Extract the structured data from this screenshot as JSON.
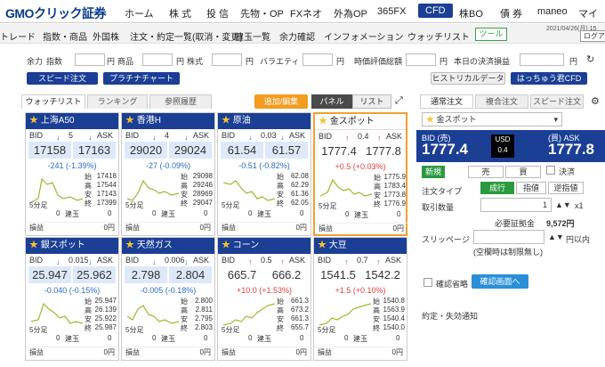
{
  "nav": {
    "logo": "GMOクリック証券",
    "items": [
      "ホーム",
      "株 式",
      "投 信",
      "先物・OP",
      "FXネオ",
      "外為OP",
      "365FX",
      "CFD",
      "株BO",
      "債 券",
      "maneo",
      "マイペー"
    ],
    "active_index": 7
  },
  "subnav": {
    "items": [
      "トレード",
      "指数・商品",
      "外国株",
      "注文・約定一覧(取消・変更)",
      "建玉一覧",
      "余力確認",
      "インフォメーション",
      "ウォッチリスト"
    ],
    "tool_label": "ツール",
    "datestamp": "2021/04/26(月) 15",
    "login_label": "ログア"
  },
  "infobar": {
    "labels": [
      "余力",
      "指数",
      "商品",
      "株式",
      "バラエティ",
      "時価評価総額",
      "本日の決済損益"
    ],
    "units": [
      "円",
      "円",
      "円",
      "円",
      "円",
      "円"
    ]
  },
  "buttons": {
    "speed": "スピード注文",
    "platinum": "プラチナチャート",
    "history": "ヒストリカルデータ",
    "hacchu": "はっちゅう君CFD",
    "add_edit": "追加/編集",
    "panel": "パネル",
    "list": "リスト",
    "confirm_skip": "確認省略",
    "confirm_screen": "確認画面へ"
  },
  "tabs": [
    "ウォッチリスト",
    "ランキング",
    "参照履歴"
  ],
  "cards": [
    {
      "name": "上海A50",
      "spread": "5",
      "bid": "17158",
      "ask": "17163",
      "chg": "-241 (-1.39%)",
      "dir": "down",
      "ohlc": [
        "17418",
        "17544",
        "17143",
        "17399"
      ],
      "tf": "5分足",
      "pos": "0",
      "pnl": "0円",
      "sel": false
    },
    {
      "name": "香港H",
      "spread": "4",
      "bid": "29020",
      "ask": "29024",
      "chg": "-27 (-0.09%)",
      "dir": "down",
      "ohlc": [
        "29098",
        "29246",
        "28969",
        "29047"
      ],
      "tf": "5分足",
      "pos": "0",
      "pnl": "0円",
      "sel": false
    },
    {
      "name": "原油",
      "spread": "0.03",
      "bid": "61.54",
      "ask": "61.57",
      "chg": "-0.51 (-0.82%)",
      "dir": "down",
      "ohlc": [
        "62.08",
        "62.29",
        "61.36",
        "62.05"
      ],
      "tf": "5分足",
      "pos": "0",
      "pnl": "0円",
      "sel": false
    },
    {
      "name": "金スポット",
      "spread": "0.4",
      "bid": "1777.4",
      "ask": "1777.8",
      "chg": "+0.5 (+0.03%)",
      "dir": "up",
      "ohlc": [
        "1775.9",
        "1783.4",
        "1773.8",
        "1776.9"
      ],
      "tf": "5分足",
      "pos": "0",
      "pnl": "0円",
      "sel": true
    },
    {
      "name": "銀スポット",
      "spread": "0.015",
      "bid": "25.947",
      "ask": "25.962",
      "chg": "-0.040 (-0.15%)",
      "dir": "down",
      "ohlc": [
        "25.947",
        "26.139",
        "25.922",
        "25.987"
      ],
      "tf": "5分足",
      "pos": "0",
      "pnl": "0円",
      "sel": false
    },
    {
      "name": "天然ガス",
      "spread": "0.006",
      "bid": "2.798",
      "ask": "2.804",
      "chg": "-0.005 (-0.18%)",
      "dir": "down",
      "ohlc": [
        "2.800",
        "2.811",
        "2.795",
        "2.803"
      ],
      "tf": "5分足",
      "pos": "0",
      "pnl": "0円",
      "sel": false
    },
    {
      "name": "コーン",
      "spread": "0.5",
      "bid": "665.7",
      "ask": "666.2",
      "chg": "+10.0 (+1.53%)",
      "dir": "up",
      "ohlc": [
        "661.3",
        "673.2",
        "661.3",
        "655.7"
      ],
      "tf": "5分足",
      "pos": "0",
      "pnl": "0円",
      "sel": false
    },
    {
      "name": "大豆",
      "spread": "0.7",
      "bid": "1541.5",
      "ask": "1542.2",
      "chg": "+1.5 (+0.10%)",
      "dir": "up",
      "ohlc": [
        "1540.8",
        "1563.9",
        "1540.4",
        "1540.0"
      ],
      "tf": "5分足",
      "pos": "0",
      "pnl": "0円",
      "sel": false
    }
  ],
  "card_labels": {
    "bid": "BID",
    "ask": "ASK",
    "o": "始",
    "h": "高",
    "l": "安",
    "c": "終",
    "pos": "建玉",
    "pnl": "損益"
  },
  "order": {
    "tabs": [
      "通常注文",
      "複合注文",
      "スピード注文"
    ],
    "symbol": "金スポット",
    "bid_label": "BID (売)",
    "ask_label": "(買) ASK",
    "bid": "1777.4",
    "ask": "1777.8",
    "ccy": "USD",
    "spread": "0.4",
    "new": "新規",
    "sell": "売",
    "buy": "買",
    "close": "決済",
    "type_label": "注文タイプ",
    "types": [
      "成行",
      "指値",
      "逆指値"
    ],
    "qty_label": "取引数量",
    "qty": "1",
    "qty_unit": "x1",
    "margin_label": "必要証拠金",
    "margin": "9,572円",
    "slip_label": "スリッページ",
    "slip_unit": "円以内",
    "slip_note": "(空欄時は制限無し)",
    "notify": "約定・失効通知"
  }
}
